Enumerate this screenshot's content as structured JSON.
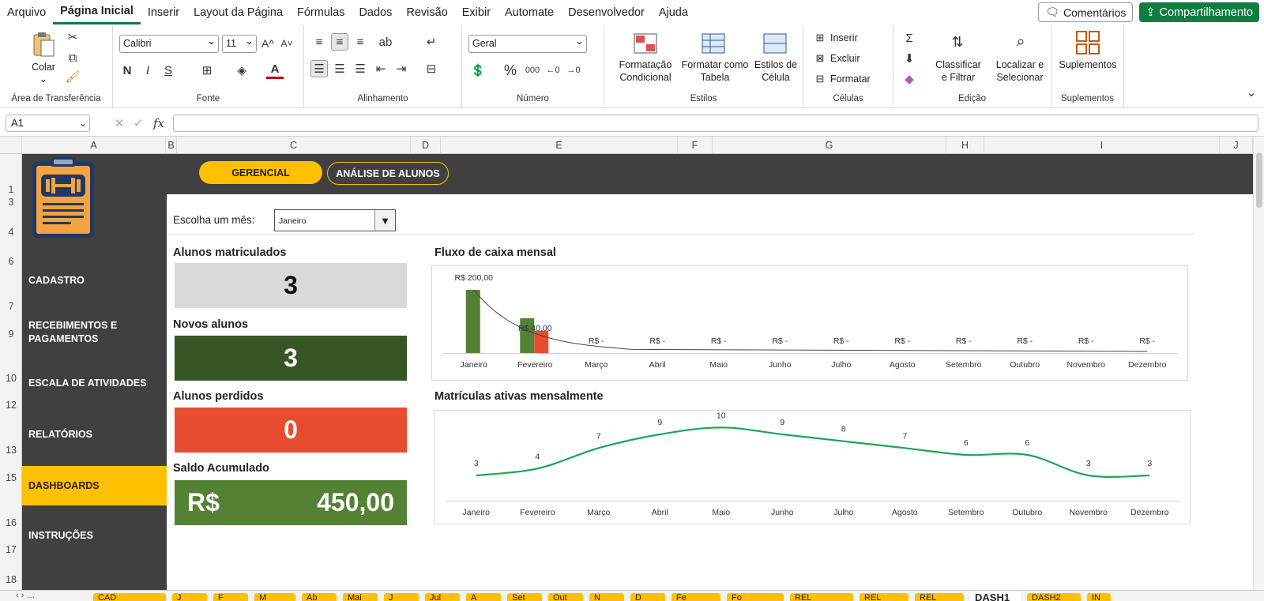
{
  "menu": {
    "items": [
      "Arquivo",
      "Página Inicial",
      "Inserir",
      "Layout da Página",
      "Fórmulas",
      "Dados",
      "Revisão",
      "Exibir",
      "Automate",
      "Desenvolvedor",
      "Ajuda"
    ],
    "active_index": 1,
    "comments_label": "Comentários",
    "share_label": "Compartilhamento"
  },
  "ribbon": {
    "clipboard": {
      "paste_label": "Colar",
      "group_label": "Área de Transferência"
    },
    "font": {
      "font_name": "Calibri",
      "font_size": "11",
      "bold": "N",
      "italic": "I",
      "underline": "S",
      "group_label": "Fonte"
    },
    "alignment": {
      "group_label": "Alinhamento"
    },
    "number": {
      "format": "Geral",
      "percent": "%",
      "thousands": "000",
      "group_label": "Número"
    },
    "styles": {
      "conditional_line1": "Formatação",
      "conditional_line2": "Condicional",
      "table_line1": "Formatar como",
      "table_line2": "Tabela",
      "cell_line1": "Estilos de",
      "cell_line2": "Célula",
      "group_label": "Estilos"
    },
    "cells": {
      "insert": "Inserir",
      "delete": "Excluir",
      "format": "Formatar",
      "group_label": "Células"
    },
    "editing": {
      "sort_line1": "Classificar",
      "sort_line2": "e Filtrar",
      "find_line1": "Localizar e",
      "find_line2": "Selecionar",
      "group_label": "Edição"
    },
    "addins": {
      "label": "Suplementos",
      "group_label": "Suplementos"
    }
  },
  "formula_bar": {
    "cell_ref": "A1",
    "fx": "fx",
    "value": ""
  },
  "columns": [
    "A",
    "B",
    "C",
    "D",
    "E",
    "F",
    "G",
    "H",
    "I",
    "J"
  ],
  "rows": [
    "1",
    "3",
    "4",
    "6",
    "7",
    "9",
    "10",
    "12",
    "13",
    "15",
    "16",
    "17",
    "18"
  ],
  "dashboard": {
    "top_buttons": {
      "gerencial": "GERENCIAL",
      "analise": "ANÁLISE DE ALUNOS"
    },
    "nav": [
      "CADASTRO",
      "RECEBIMENTOS E PAGAMENTOS",
      "ESCALA DE ATIVIDADES",
      "RELATÓRIOS",
      "DASHBOARDS",
      "INSTRUÇÕES"
    ],
    "nav_active_index": 4,
    "month_label": "Escolha um mês:",
    "month_value": "Janeiro",
    "kpis": {
      "matriculados": {
        "title": "Alunos matriculados",
        "value": "3"
      },
      "novos": {
        "title": "Novos alunos",
        "value": "3"
      },
      "perdidos": {
        "title": "Alunos perdidos",
        "value": "0"
      },
      "saldo": {
        "title": "Saldo Acumulado",
        "currency": "R$",
        "value": "450,00"
      }
    },
    "colors": {
      "dark": "#404040",
      "yellow": "#ffc000",
      "gray": "#d9d9d9",
      "dark_green": "#375623",
      "red": "#e84c30",
      "green": "#548235",
      "line_green": "#21a357"
    }
  },
  "chart_data": [
    {
      "type": "bar",
      "title": "Fluxo de caixa mensal",
      "categories": [
        "Janeiro",
        "Fevereiro",
        "Março",
        "Abril",
        "Maio",
        "Junho",
        "Julho",
        "Agosto",
        "Setembro",
        "Outubro",
        "Novembro",
        "Dezembro"
      ],
      "series": [
        {
          "values": [
            200,
            110,
            0,
            0,
            0,
            0,
            0,
            0,
            0,
            0,
            0,
            0
          ],
          "color": "#548235"
        },
        {
          "values": [
            0,
            70,
            0,
            0,
            0,
            0,
            0,
            0,
            0,
            0,
            0,
            0
          ],
          "color": "#e84c30"
        }
      ],
      "data_labels": [
        "R$ 200,00",
        "R$ 40,00",
        "R$ -",
        "R$ -",
        "R$ -",
        "R$ -",
        "R$ -",
        "R$ -",
        "R$ -",
        "R$ -",
        "R$ -",
        "R$ -"
      ],
      "trendline": true,
      "ylim": [
        0,
        200
      ],
      "grid": false
    },
    {
      "type": "line",
      "title": "Matrículas ativas mensalmente",
      "categories": [
        "Janeiro",
        "Fevereiro",
        "Março",
        "Abril",
        "Maio",
        "Junho",
        "Julho",
        "Agosto",
        "Setembro",
        "Outubro",
        "Novembro",
        "Dezembro"
      ],
      "series": [
        {
          "values": [
            3,
            4,
            7,
            9,
            10,
            9,
            8,
            7,
            6,
            6,
            3,
            3
          ],
          "color": "#21a357"
        }
      ],
      "ylim": [
        0,
        12
      ],
      "grid": false
    }
  ],
  "sheet_tabs": [
    "CAD",
    "J",
    "F",
    "M",
    "Ab",
    "Mai",
    "J",
    "Jul",
    "A",
    "Set",
    "Out",
    "N",
    "D",
    "Fe",
    "Fo",
    "REL",
    "REL",
    "REL",
    "DASH1",
    "DASH2",
    "IN"
  ],
  "active_tab_index": 18
}
